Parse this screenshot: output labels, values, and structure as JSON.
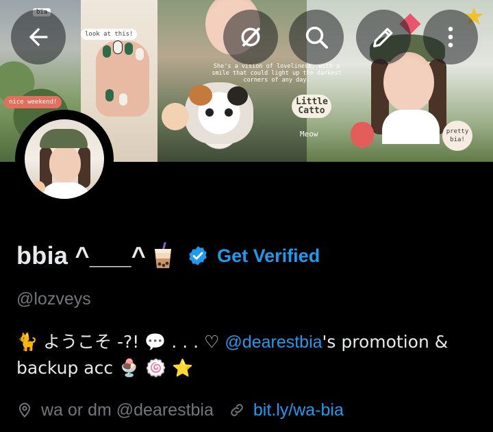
{
  "banner": {
    "stickers": {
      "bia": "bia",
      "look": "look at this!",
      "weekend": "nice weekend!",
      "vision": "She's a vision of loveliness, with a smile that could light up the darkest corners of any day.",
      "little_catto": "Little Catto",
      "meow": "Meow",
      "pretty": "pretty bia!"
    }
  },
  "top_actions": {
    "back_icon": "arrow-left-icon",
    "grok_icon": "grok-icon",
    "search_icon": "search-icon",
    "edit_icon": "pencil-icon",
    "more_icon": "more-vertical-icon"
  },
  "profile": {
    "display_name": "bbia ^___^",
    "name_emoji": "bubble-tea",
    "verified_badge": "verified-badge-icon",
    "get_verified_label": "Get Verified",
    "handle": "@lozveys",
    "bio": {
      "part1": "🐈 ようこそ -?! 💬 . . . ♡ ",
      "mention": "@dearestbia",
      "part2": "'s promotion & backup acc 🍨 🍥 ⭐"
    },
    "location": "wa or dm @dearestbia",
    "link": "bit.ly/wa-bia"
  },
  "colors": {
    "accent": "#1d9bf0",
    "background": "#000000",
    "primary_text": "#e7e9ea",
    "secondary_text": "#71767b"
  }
}
